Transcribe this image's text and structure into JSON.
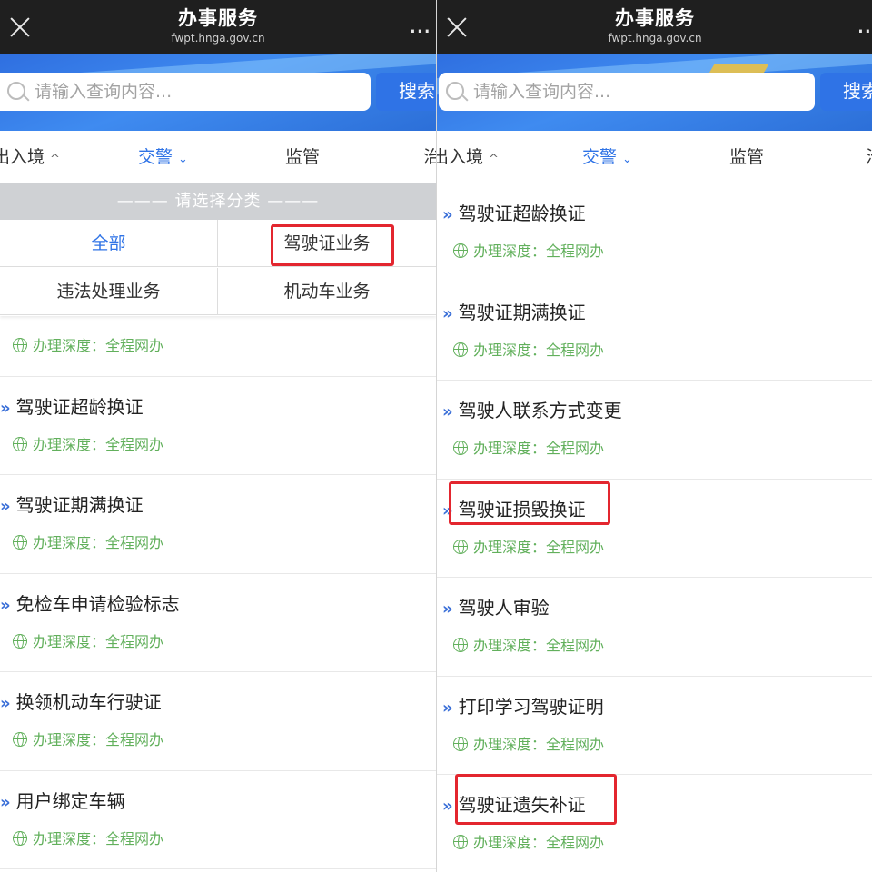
{
  "left": {
    "topbar": {
      "title": "办事服务",
      "domain": "fwpt.hnga.gov.cn",
      "more": "..."
    },
    "search": {
      "placeholder": "请输入查询内容...",
      "button": "搜索"
    },
    "tabs": [
      {
        "label": "出入境",
        "arrow": "^"
      },
      {
        "label": "交警",
        "arrow": "⌄"
      },
      {
        "label": "监管",
        "arrow": ""
      },
      {
        "label": "治",
        "arrow": ""
      }
    ],
    "filter": {
      "header": "——— 请选择分类 ———",
      "options": [
        "全部",
        "驾驶证业务",
        "违法处理业务",
        "机动车业务"
      ]
    },
    "partial_item": {
      "meta": "办理深度：全程网办"
    },
    "items": [
      {
        "title": "驾驶证超龄换证",
        "meta": "办理深度：全程网办"
      },
      {
        "title": "驾驶证期满换证",
        "meta": "办理深度：全程网办"
      },
      {
        "title": "免检车申请检验标志",
        "meta": "办理深度：全程网办"
      },
      {
        "title": "换领机动车行驶证",
        "meta": "办理深度：全程网办"
      },
      {
        "title": "用户绑定车辆",
        "meta": "办理深度：全程网办"
      }
    ]
  },
  "right": {
    "topbar": {
      "title": "办事服务",
      "domain": "fwpt.hnga.gov.cn",
      "more": ".."
    },
    "search": {
      "placeholder": "请输入查询内容...",
      "button": "搜索"
    },
    "tabs": [
      {
        "label": "出入境",
        "arrow": "^"
      },
      {
        "label": "交警",
        "arrow": "⌄"
      },
      {
        "label": "监管",
        "arrow": ""
      },
      {
        "label": "治",
        "arrow": ""
      }
    ],
    "items": [
      {
        "title": "驾驶证超龄换证",
        "meta": "办理深度：全程网办"
      },
      {
        "title": "驾驶证期满换证",
        "meta": "办理深度：全程网办"
      },
      {
        "title": "驾驶人联系方式变更",
        "meta": "办理深度：全程网办"
      },
      {
        "title": "驾驶证损毁换证",
        "meta": "办理深度：全程网办"
      },
      {
        "title": "驾驶人审验",
        "meta": "办理深度：全程网办"
      },
      {
        "title": "打印学习驾驶证明",
        "meta": "办理深度：全程网办"
      },
      {
        "title": "驾驶证遗失补证",
        "meta": "办理深度：全程网办"
      }
    ]
  },
  "colors": {
    "accent": "#2f73e6",
    "highlight": "#e3262f",
    "meta_green": "#62b05c",
    "topbar": "#1f1f1f"
  },
  "icons": {
    "close": "close-icon",
    "more": "more-icon",
    "search": "search-icon",
    "globe": "globe-icon",
    "chevron": "double-chevron-icon"
  }
}
